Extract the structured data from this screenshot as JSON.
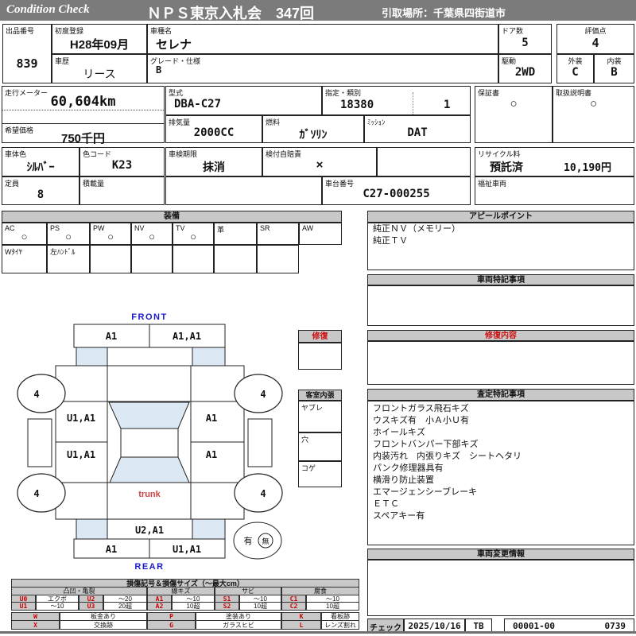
{
  "header": {
    "logo": "Condition  Check",
    "title": "ＮＰＳ東京入札会　347回",
    "pickup": "引取場所：千葉県四街道市"
  },
  "vehicle": {
    "lot": {
      "label": "出品番号",
      "value": "839"
    },
    "first_reg": {
      "label": "初度登録",
      "value": "H28年09月"
    },
    "model": {
      "label": "車種名",
      "value": "セレナ"
    },
    "doors": {
      "label": "ドア数",
      "value": "5"
    },
    "score": {
      "label": "評価点",
      "value": "4"
    },
    "history": {
      "label": "車歴",
      "value": "リース"
    },
    "grade": {
      "label": "グレード・仕様",
      "value": "B"
    },
    "drive": {
      "label": "駆動",
      "value": "2WD"
    },
    "exterior": {
      "label": "外装",
      "value": "C"
    },
    "interior": {
      "label": "内装",
      "value": "B"
    },
    "odometer": {
      "label": "走行メーター",
      "value": "60,604km"
    },
    "price": {
      "label": "希望価格",
      "value": "750千円"
    },
    "model_code": {
      "label": "型式",
      "value": "DBA-C27"
    },
    "designation": {
      "label": "指定・類別",
      "value1": "18380",
      "value2": "1"
    },
    "displacement": {
      "label": "排気量",
      "value": "2000CC"
    },
    "fuel": {
      "label": "燃料",
      "value": "ｶﾞｿﾘﾝ"
    },
    "mission": {
      "label": "ﾐｯｼｮﾝ",
      "value": "DAT"
    },
    "warranty": {
      "label": "保証書",
      "value": "○"
    },
    "manual": {
      "label": "取扱説明書",
      "value": "○"
    },
    "body_color": {
      "label": "車体色",
      "value": "ｼﾙﾊﾞｰ"
    },
    "color_code": {
      "label": "色コード",
      "value": "K23"
    },
    "inspection": {
      "label": "車検期限",
      "value": "抹消"
    },
    "insurance": {
      "label": "検付自賠責",
      "value": "×"
    },
    "recycle": {
      "label": "リサイクル料",
      "status": "預託済",
      "amount": "10,190円"
    },
    "capacity": {
      "label": "定員",
      "value": "8"
    },
    "load": {
      "label": "積載量",
      "value": ""
    },
    "chassis": {
      "label": "車台番号",
      "value": "C27-000255"
    },
    "welfare": {
      "label": "福祉車両",
      "value": ""
    }
  },
  "equipment": {
    "title": "装備",
    "items": [
      {
        "label": "AC",
        "value": "○"
      },
      {
        "label": "PS",
        "value": "○"
      },
      {
        "label": "PW",
        "value": "○"
      },
      {
        "label": "NV",
        "value": "○"
      },
      {
        "label": "TV",
        "value": "○"
      },
      {
        "label": "革",
        "value": ""
      },
      {
        "label": "SR",
        "value": ""
      },
      {
        "label": "AW",
        "value": ""
      }
    ],
    "extras": [
      "Wﾀｲﾔ",
      "左ﾊﾝﾄﾞﾙ",
      "",
      "",
      "",
      "",
      ""
    ]
  },
  "appeal": {
    "title": "アピールポイント",
    "lines": [
      "純正ＮＶ（メモリー）",
      "純正ＴＶ"
    ]
  },
  "notes": {
    "title": "車両特記事項"
  },
  "repair": {
    "title": "修復内容"
  },
  "assessment": {
    "title": "査定特記事項",
    "lines": [
      "フロントガラス飛石キズ",
      "ウスキズ有　小Ａ小Ｕ有",
      "ホイールキズ",
      "フロントバンパー下部キズ",
      "内装汚れ　内張りキズ　シートヘタリ",
      "パンク修理器具有",
      "横滑り防止装置",
      "エマージェンシーブレーキ",
      "ＥＴＣ",
      "スペアキー有"
    ]
  },
  "change_info": {
    "title": "車両変更情報"
  },
  "check": {
    "label": "チェック",
    "date": "2025/10/16",
    "inspector": "TB",
    "code": "00001-00",
    "number": "0739"
  },
  "diagram": {
    "front": "FRONT",
    "rear": "REAR",
    "trunk": "trunk",
    "repair_box_title": "修復",
    "cabin": {
      "title": "客室内張",
      "rows": [
        "ヤブレ",
        "穴",
        "コゲ"
      ]
    },
    "marks": {
      "front_bumper_left": "A1",
      "front_bumper_right": "A1,A1",
      "left_front_panel": "U1,A1",
      "left_rear_panel": "U1,A1",
      "right_front_panel": "A1",
      "right_rear_panel": "A1",
      "rear_gate": "U2,A1",
      "rear_bumper_left": "A1",
      "rear_bumper_right": "U1,A1",
      "tire_front_left": "4",
      "tire_front_right": "4",
      "tire_rear_left": "4",
      "tire_rear_right": "4"
    },
    "accident": {
      "yes": "有",
      "no": "無"
    }
  },
  "legend": {
    "title": "損傷記号＆損傷サイズ（～最大cm）",
    "groups": [
      "凸凹・亀裂",
      "線キズ",
      "サビ",
      "腐食"
    ],
    "rows": [
      [
        "U0",
        "エクボ",
        "U2",
        "～20",
        "A1",
        "～10",
        "S1",
        "～10",
        "C1",
        "～10"
      ],
      [
        "U1",
        "～10",
        "U3",
        "20超",
        "A2",
        "10超",
        "S2",
        "10超",
        "C2",
        "10超"
      ]
    ],
    "codes": [
      [
        "W",
        "板金あり",
        "P",
        "塗装あり",
        "K",
        "看板跡"
      ],
      [
        "X",
        "交換跡",
        "G",
        "ガラスヒビ",
        "L",
        "レンズ割れ"
      ]
    ]
  },
  "colors": {
    "bar": "#7b7b7b",
    "section_bg": "#c8c8c8",
    "red": "#cc0000",
    "blue": "#1a1acd",
    "glass": "#dce8f3"
  }
}
